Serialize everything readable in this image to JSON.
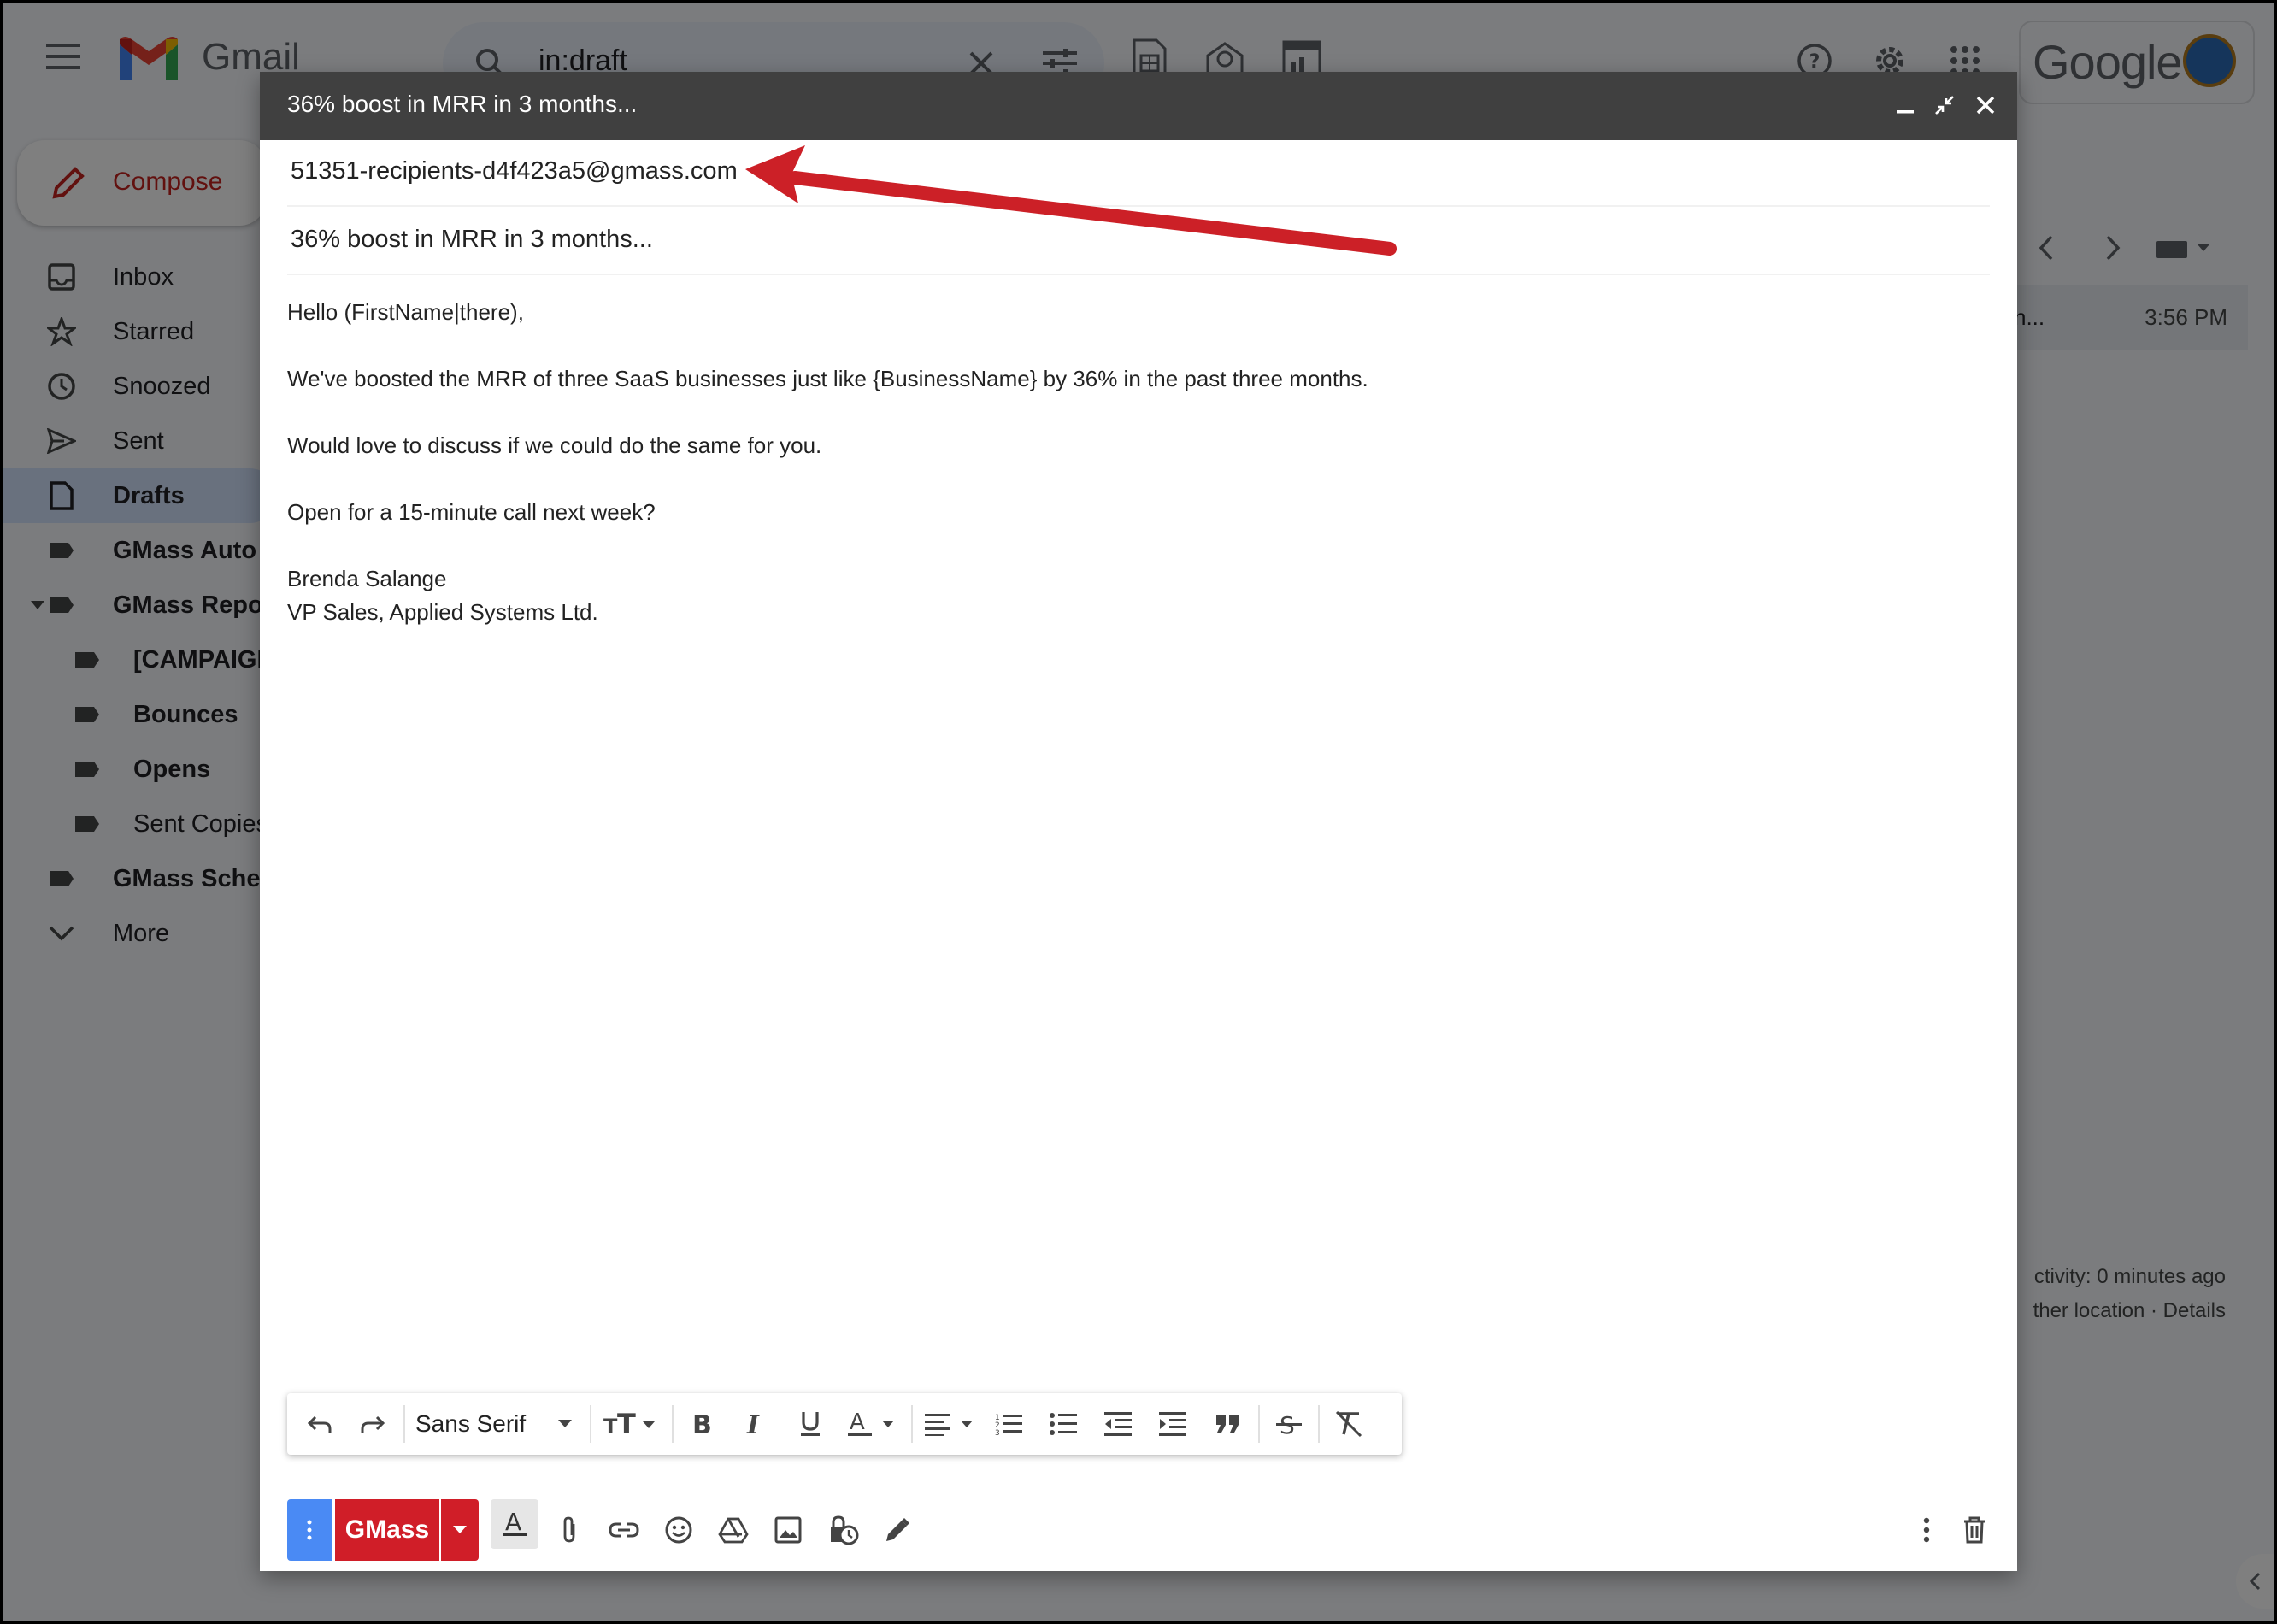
{
  "gmail": {
    "app_name": "Gmail",
    "search_value": "in:draft",
    "google_word": "Google",
    "compose_label": "Compose",
    "nav": [
      {
        "label": "Inbox"
      },
      {
        "label": "Starred"
      },
      {
        "label": "Snoozed"
      },
      {
        "label": "Sent"
      },
      {
        "label": "Drafts"
      },
      {
        "label": "GMass Auto F"
      },
      {
        "label": "GMass Repor"
      },
      {
        "label": "[CAMPAIGN"
      },
      {
        "label": "Bounces"
      },
      {
        "label": "Opens"
      },
      {
        "label": "Sent Copies"
      },
      {
        "label": "GMass Sched"
      },
      {
        "label": "More"
      }
    ],
    "email_row": {
      "snippet": "n...",
      "time": "3:56 PM"
    },
    "activity": {
      "line1": "ctivity: 0 minutes ago",
      "line2": "ther location · Details"
    }
  },
  "compose": {
    "title": "36% boost in MRR in 3 months...",
    "to": "51351-recipients-d4f423a5@gmass.com",
    "subject": "36% boost in MRR in 3 months...",
    "body": {
      "greeting": "Hello (FirstName|there),",
      "line1": "We've boosted the MRR of three SaaS businesses just like {BusinessName} by 36% in the past three months.",
      "line2": "Would love to discuss if we could do the same for you.",
      "line3": "Open for a 15-minute call next week?",
      "sig_name": "Brenda Salange",
      "sig_title": "VP Sales, Applied Systems Ltd."
    },
    "font_name": "Sans Serif",
    "send_label": "GMass"
  },
  "colors": {
    "gmass_red": "#d01e28",
    "send_blue": "#4a8af4",
    "header_dark": "#404040",
    "annotation_arrow": "#cc2027"
  }
}
